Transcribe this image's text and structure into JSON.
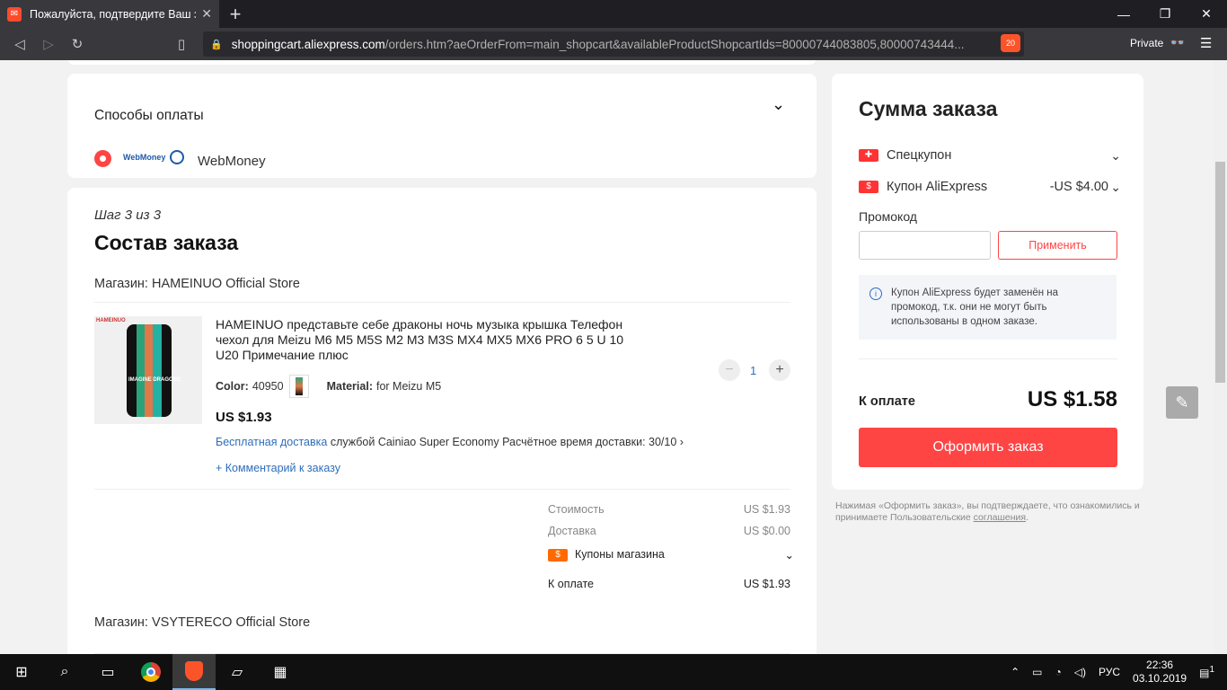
{
  "browser": {
    "tab_title": "Пожалуйста, подтвердите Ваш за",
    "tab_favicon": "aliexpress-favicon",
    "url_domain": "shoppingcart.aliexpress.com",
    "url_path": "/orders.htm?aeOrderFrom=main_shopcart&availableProductShopcartIds=80000744083805,80000743444...",
    "shield_count": "20",
    "private_label": "Private"
  },
  "payment": {
    "title": "Способы оплаты",
    "method_logo": "WebMoney",
    "method_label": "WebMoney"
  },
  "order": {
    "step": "Шаг 3 из 3",
    "title": "Состав заказа",
    "store1": "Магазин: HAMEINUO Official Store",
    "product": {
      "name": "HAMEINUO представьте себе драконы ночь музыка крышка Телефон чехол для Meizu M6 M5 M5S M2 M3 M3S MX4 MX5 MX6 PRO 6 5 U 10 U20 Примечание плюс",
      "image_brand": "HAMEINUO",
      "image_text": "IMAGINE DRAGONS",
      "color_label": "Color:",
      "color_value": "40950",
      "material_label": "Material:",
      "material_value": "for Meizu M5",
      "price": "US $1.93",
      "quantity": "1",
      "shipping_free": "Бесплатная доставка",
      "shipping_service": "службой Cainiao Super Economy",
      "shipping_eta": "Расчётное время доставки: 30/10",
      "comment_link": "+ Комментарий к заказу"
    },
    "summary": {
      "cost_label": "Стоимость",
      "cost_value": "US $1.93",
      "delivery_label": "Доставка",
      "delivery_value": "US $0.00",
      "store_coupons_label": "Купоны магазина",
      "topay_label": "К оплате",
      "topay_value": "US $1.93"
    },
    "store2": "Магазин: VSYTERECO Official Store"
  },
  "order_summary": {
    "title": "Сумма заказа",
    "special_coupon_label": "Спецкупон",
    "ae_coupon_label": "Купон AliExpress",
    "ae_coupon_value": "-US $4.00",
    "promo_label": "Промокод",
    "promo_placeholder": "",
    "apply_label": "Применить",
    "info_text": "Купон AliExpress будет заменён на промокод, т.к. они не могут быть использованы в одном заказе.",
    "topay_label": "К оплате",
    "topay_value": "US $1.58",
    "checkout_label": "Оформить заказ",
    "legal_text": "Нажимая «Оформить заказ», вы подтверждаете, что ознакомились и принимаете Пользовательские",
    "legal_link": "соглашения",
    "legal_end": "."
  },
  "taskbar": {
    "lang": "РУС",
    "time": "22:36",
    "date": "03.10.2019",
    "notifications": "1"
  },
  "colors": {
    "accent": "#ff4747",
    "link": "#2e6dba",
    "page_bg": "#f2f2f2"
  }
}
